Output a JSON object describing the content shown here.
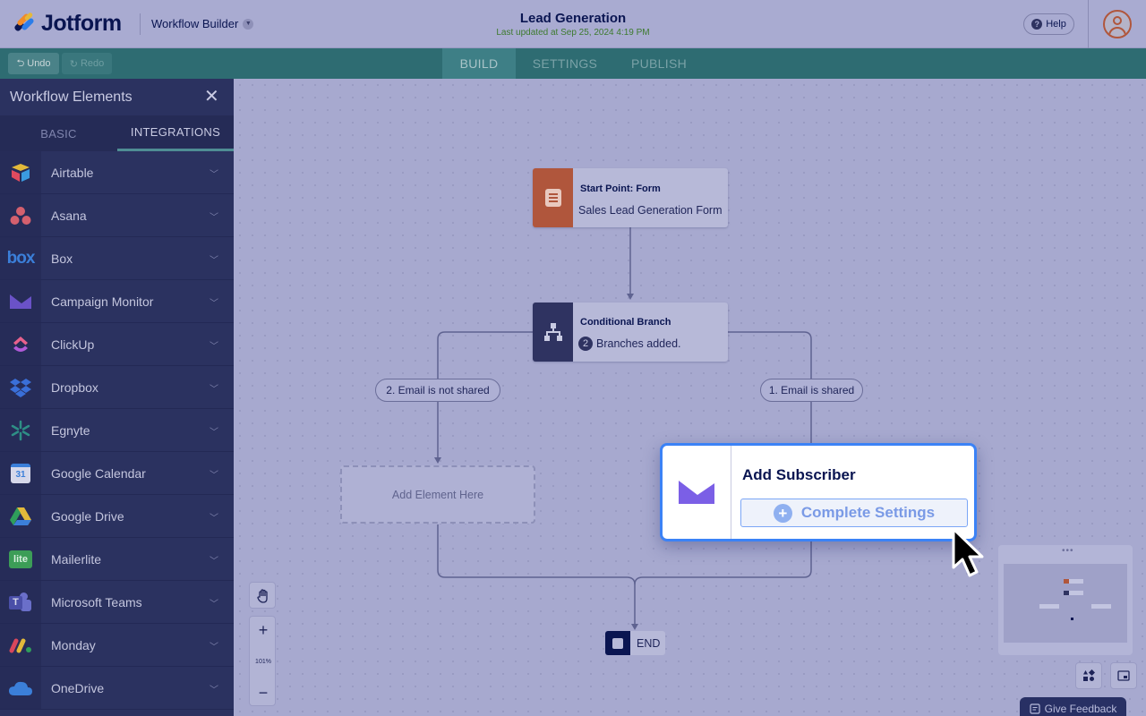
{
  "header": {
    "logo_text": "Jotform",
    "app_switch_label": "Workflow Builder",
    "title": "Lead Generation",
    "subtitle": "Last updated at Sep 25, 2024 4:19 PM",
    "help_label": "Help",
    "help_glyph": "?"
  },
  "toolbar": {
    "undo_label": "Undo",
    "redo_label": "Redo",
    "tabs": [
      {
        "label": "BUILD",
        "active": true
      },
      {
        "label": "SETTINGS",
        "active": false
      },
      {
        "label": "PUBLISH",
        "active": false
      }
    ]
  },
  "sidebar": {
    "title": "Workflow Elements",
    "close_glyph": "✕",
    "tabs": [
      {
        "label": "BASIC",
        "active": false
      },
      {
        "label": "INTEGRATIONS",
        "active": true
      }
    ],
    "items": [
      {
        "label": "Airtable",
        "icon": "airtable-icon"
      },
      {
        "label": "Asana",
        "icon": "asana-icon"
      },
      {
        "label": "Box",
        "icon": "box-icon",
        "icon_text": "box"
      },
      {
        "label": "Campaign Monitor",
        "icon": "campaign-monitor-icon"
      },
      {
        "label": "ClickUp",
        "icon": "clickup-icon"
      },
      {
        "label": "Dropbox",
        "icon": "dropbox-icon"
      },
      {
        "label": "Egnyte",
        "icon": "egnyte-icon"
      },
      {
        "label": "Google Calendar",
        "icon": "google-calendar-icon",
        "icon_text": "31"
      },
      {
        "label": "Google Drive",
        "icon": "google-drive-icon"
      },
      {
        "label": "Mailerlite",
        "icon": "mailerlite-icon",
        "icon_text": "lite"
      },
      {
        "label": "Microsoft Teams",
        "icon": "microsoft-teams-icon",
        "icon_text": "T"
      },
      {
        "label": "Monday",
        "icon": "monday-icon"
      },
      {
        "label": "OneDrive",
        "icon": "onedrive-icon"
      }
    ]
  },
  "canvas": {
    "start_node": {
      "title": "Start Point: Form",
      "subtitle": "Sales Lead Generation Form"
    },
    "branch_node": {
      "title": "Conditional Branch",
      "count": "2",
      "subtitle": "Branches added."
    },
    "branch_left_label": "2. Email is not shared",
    "branch_right_label": "1. Email is shared",
    "add_element_label": "Add Element Here",
    "end_label": "END",
    "card": {
      "title": "Add Subscriber",
      "button_label": "Complete Settings",
      "plus_glyph": "+"
    },
    "zoom": {
      "level": "101%",
      "plus_glyph": "+",
      "minus_glyph": "−"
    },
    "feedback_label": "Give Feedback"
  },
  "colors": {
    "header_bg": "#a9abd1",
    "toolbar_bg": "#2e6c72",
    "sidebar_bg": "#2b3260",
    "start_strip": "#b0563c",
    "branch_strip": "#2f3361",
    "card_border": "#3b82f6",
    "campaign_monitor": "#7b5fe6"
  }
}
